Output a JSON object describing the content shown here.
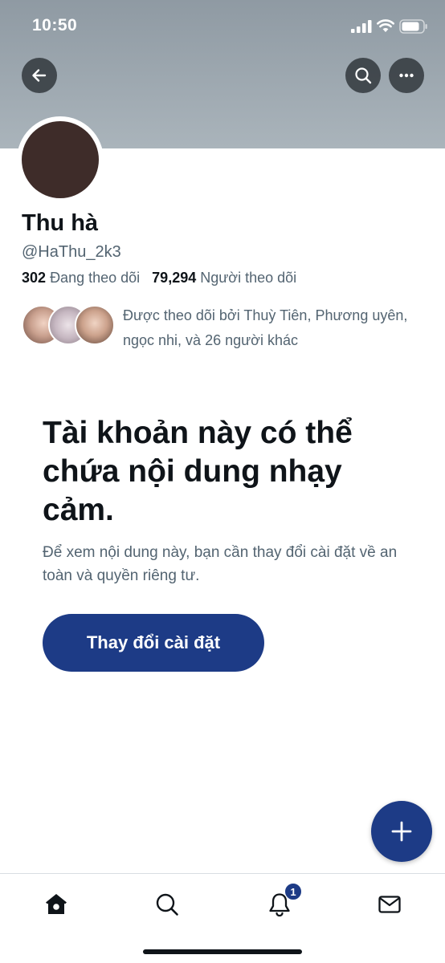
{
  "status_bar": {
    "time": "10:50"
  },
  "profile": {
    "display_name": "Thu hà",
    "handle": "@HaThu_2k3",
    "following_count": "302",
    "following_label": "Đang theo dõi",
    "followers_count": "79,294",
    "followers_label": "Người theo dõi",
    "followed_by_text": "Được theo dõi bởi Thuỳ Tiên, Phương uyên, ngọc nhi, và 26 người khác"
  },
  "sensitive_notice": {
    "title": "Tài khoản này có thể chứa nội dung nhạy cảm.",
    "description": "Để xem nội dung này, bạn cần thay đổi cài đặt về an toàn và quyền riêng tư.",
    "button_label": "Thay đổi cài đặt"
  },
  "bottom_nav": {
    "items": [
      {
        "icon": "home-icon"
      },
      {
        "icon": "search-icon"
      },
      {
        "icon": "bell-icon"
      },
      {
        "icon": "mail-icon"
      }
    ],
    "notification_badge": "1"
  },
  "colors": {
    "accent": "#1d3b86",
    "banner": "#9ea9b1",
    "secondary_text": "#536471"
  }
}
